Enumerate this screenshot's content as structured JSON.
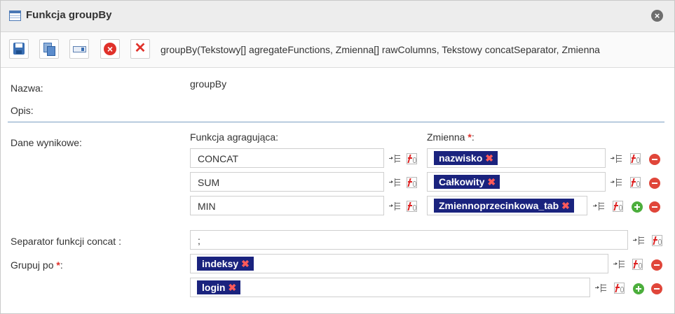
{
  "dialog": {
    "title": "Funkcja groupBy",
    "close_icon": "close-circle-icon"
  },
  "toolbar": {
    "buttons": [
      {
        "name": "save",
        "icon": "floppy-disk-icon"
      },
      {
        "name": "duplicate",
        "icon": "copy-icon"
      },
      {
        "name": "rename",
        "icon": "input-field-icon"
      },
      {
        "name": "cancel",
        "icon": "red-circle-x-icon"
      },
      {
        "name": "delete",
        "icon": "red-x-icon"
      }
    ],
    "signature": "groupBy(Tekstowy[] agregateFunctions, Zmienna[] rawColumns, Tekstowy concatSeparator, Zmienna"
  },
  "form": {
    "name_label": "Nazwa:",
    "name_value": "groupBy",
    "desc_label": "Opis:",
    "result_label": "Dane wynikowe:",
    "agg_header": "Funkcja agragująca:",
    "var_header": "Zmienna",
    "required_mark": "*",
    "colon": ":",
    "rows": [
      {
        "func": "CONCAT",
        "var": "nazwisko"
      },
      {
        "func": "SUM",
        "var": "Całkowity"
      },
      {
        "func": "MIN",
        "var": "Zmiennoprzecinkowa_tab"
      }
    ],
    "separator_label": "Separator funkcji concat :",
    "separator_value": ";",
    "groupby_label": "Grupuj po",
    "groupby_colon": ":",
    "groupby_items": [
      "indeksy",
      "login"
    ],
    "tag_remove": "✖"
  },
  "colors": {
    "tag_bg": "#1a237e",
    "tag_remove": "#ff5a5a",
    "required": "#e0312a",
    "divider": "#7b9fc2"
  }
}
